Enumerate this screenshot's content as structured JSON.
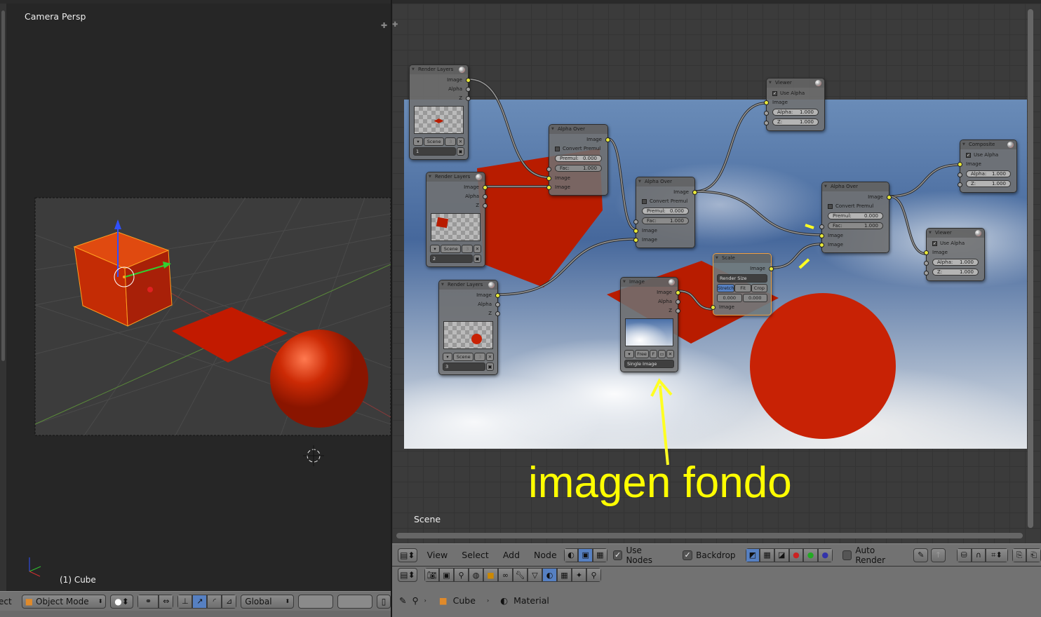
{
  "viewport": {
    "view_label": "Camera Persp",
    "object_label": "(1) Cube",
    "toolbar": {
      "truncated_menu": "ect",
      "mode": "Object Mode",
      "orientation": "Global"
    }
  },
  "node_editor": {
    "scene_label": "Scene",
    "annotation": "imagen fondo",
    "annotation_color": "#ffff00",
    "header": {
      "menus": [
        "View",
        "Select",
        "Add",
        "Node"
      ],
      "use_nodes_label": "Use Nodes",
      "use_nodes": true,
      "backdrop_label": "Backdrop",
      "backdrop": true,
      "auto_render_label": "Auto Render",
      "auto_render": false
    },
    "breadcrumb": [
      "Cube",
      "Material"
    ],
    "nodes": [
      {
        "id": "rl1",
        "title": "Render Layers",
        "rows": [
          {
            "t": "out",
            "l": "Image",
            "y": 1
          },
          {
            "t": "out",
            "l": "Alpha"
          },
          {
            "t": "out",
            "l": "Z"
          },
          {
            "t": "preview",
            "img": "rl1"
          },
          {
            "t": "scene",
            "l": "Scene",
            "n": "3"
          },
          {
            "t": "layer",
            "l": "1"
          }
        ]
      },
      {
        "id": "rl2",
        "title": "Render Layers",
        "rows": [
          {
            "t": "out",
            "l": "Image",
            "y": 1
          },
          {
            "t": "out",
            "l": "Alpha"
          },
          {
            "t": "out",
            "l": "Z"
          },
          {
            "t": "preview",
            "img": "rl2"
          },
          {
            "t": "scene",
            "l": "Scene",
            "n": "3"
          },
          {
            "t": "layer",
            "l": "2"
          }
        ]
      },
      {
        "id": "rl3",
        "title": "Render Layers",
        "rows": [
          {
            "t": "out",
            "l": "Image",
            "y": 1
          },
          {
            "t": "out",
            "l": "Alpha"
          },
          {
            "t": "out",
            "l": "Z"
          },
          {
            "t": "preview",
            "img": "rl3"
          },
          {
            "t": "scene",
            "l": "Scene",
            "n": "3"
          },
          {
            "t": "layer",
            "l": "3"
          }
        ]
      },
      {
        "id": "ao1",
        "title": "Alpha Over",
        "rows": [
          {
            "t": "out",
            "l": "Image",
            "y": 1
          },
          {
            "t": "check",
            "l": "Convert Premul",
            "v": false
          },
          {
            "t": "fld",
            "l": "Premul:",
            "v": "0.000"
          },
          {
            "t": "fld",
            "l": "Fac:",
            "v": "1.000",
            "s": 1,
            "dk": 1
          },
          {
            "t": "in",
            "l": "Image",
            "y": 1
          },
          {
            "t": "in",
            "l": "Image",
            "y": 1
          }
        ]
      },
      {
        "id": "ao2",
        "title": "Alpha Over",
        "rows": [
          {
            "t": "out",
            "l": "Image",
            "y": 1
          },
          {
            "t": "check",
            "l": "Convert Premul",
            "v": false
          },
          {
            "t": "fld",
            "l": "Premul:",
            "v": "0.000"
          },
          {
            "t": "fld",
            "l": "Fac:",
            "v": "1.000",
            "s": 1,
            "dk": 1
          },
          {
            "t": "in",
            "l": "Image",
            "y": 1
          },
          {
            "t": "in",
            "l": "Image",
            "y": 1
          }
        ]
      },
      {
        "id": "ao3",
        "title": "Alpha Over",
        "rows": [
          {
            "t": "out",
            "l": "Image",
            "y": 1
          },
          {
            "t": "check",
            "l": "Convert Premul",
            "v": false
          },
          {
            "t": "fld",
            "l": "Premul:",
            "v": "0.000"
          },
          {
            "t": "fld",
            "l": "Fac:",
            "v": "1.000",
            "s": 1,
            "dk": 1
          },
          {
            "t": "in",
            "l": "Image",
            "y": 1
          },
          {
            "t": "in",
            "l": "Image",
            "y": 1
          }
        ]
      },
      {
        "id": "v1",
        "title": "Viewer",
        "rows": [
          {
            "t": "check",
            "l": "Use Alpha",
            "v": true
          },
          {
            "t": "in",
            "l": "Image",
            "y": 1
          },
          {
            "t": "fld",
            "l": "Alpha:",
            "v": "1.000",
            "s": 1
          },
          {
            "t": "fld",
            "l": "Z:",
            "v": "1.000",
            "s": 1
          }
        ]
      },
      {
        "id": "comp",
        "title": "Composite",
        "rows": [
          {
            "t": "check",
            "l": "Use Alpha",
            "v": true
          },
          {
            "t": "in",
            "l": "Image",
            "y": 1
          },
          {
            "t": "fld",
            "l": "Alpha:",
            "v": "1.000",
            "s": 1
          },
          {
            "t": "fld",
            "l": "Z:",
            "v": "1.000",
            "s": 1
          }
        ]
      },
      {
        "id": "v2",
        "title": "Viewer",
        "rows": [
          {
            "t": "check",
            "l": "Use Alpha",
            "v": true
          },
          {
            "t": "in",
            "l": "Image",
            "y": 1
          },
          {
            "t": "fld",
            "l": "Alpha:",
            "v": "1.000",
            "s": 1
          },
          {
            "t": "fld",
            "l": "Z:",
            "v": "1.000",
            "s": 1
          }
        ]
      },
      {
        "id": "img",
        "title": "Image",
        "rows": [
          {
            "t": "out",
            "l": "Image",
            "y": 1
          },
          {
            "t": "out",
            "l": "Alpha"
          },
          {
            "t": "out",
            "l": "Z"
          },
          {
            "t": "preview",
            "img": "sky"
          },
          {
            "t": "imgbtns",
            "a": "Free",
            "b": "F"
          },
          {
            "t": "select",
            "l": "Single Image"
          }
        ]
      },
      {
        "id": "scale",
        "title": "Scale",
        "sel": true,
        "rows": [
          {
            "t": "out",
            "l": "Image",
            "y": 1
          },
          {
            "t": "select",
            "l": "Render Size"
          },
          {
            "t": "tri",
            "opts": [
              "Stretch",
              "Fit",
              "Crop"
            ],
            "active": 0
          },
          {
            "t": "pair",
            "a": "0.000",
            "b": "0.000"
          },
          {
            "t": "in",
            "l": "Image",
            "y": 1
          }
        ]
      }
    ]
  }
}
